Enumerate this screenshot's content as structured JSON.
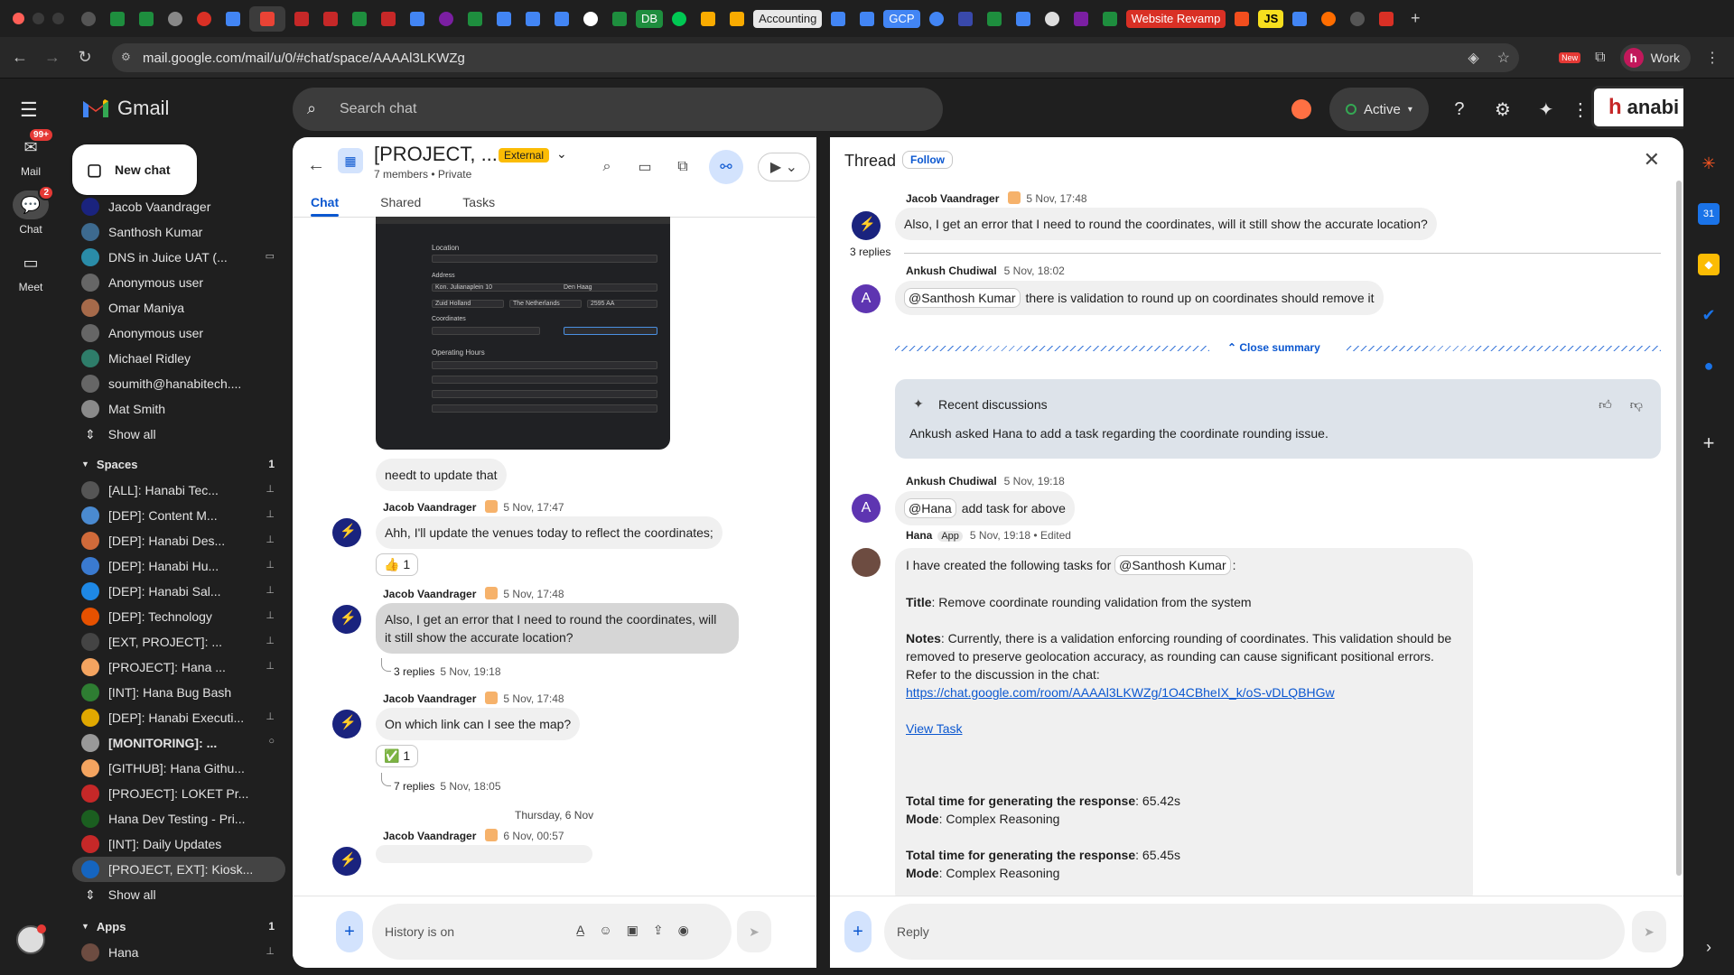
{
  "browser": {
    "tab_labels": {
      "db": "DB",
      "accounting": "Accounting",
      "gcp": "GCP",
      "website": "Website Revamp",
      "js": "JS"
    },
    "url": "mail.google.com/mail/u/0/#chat/space/AAAAl3LKWZg",
    "profile": "Work",
    "new_badge": "New"
  },
  "rail": {
    "mail_label": "Mail",
    "mail_badge": "99+",
    "chat_label": "Chat",
    "chat_badge": "2",
    "meet_label": "Meet"
  },
  "header": {
    "app_name": "Gmail",
    "search_placeholder": "Search chat",
    "status": "Active",
    "org_name": "anabi"
  },
  "sidebar": {
    "new_chat": "New chat",
    "dms": [
      {
        "name": "Jacob Vaandrager",
        "color": "#1a237e"
      },
      {
        "name": "Santhosh Kumar",
        "color": "#3d6a8f"
      },
      {
        "name": "DNS in Juice UAT (...",
        "color": "#2a8ca8"
      },
      {
        "name": "Anonymous user",
        "color": "#666"
      },
      {
        "name": "Omar Maniya",
        "color": "#a66a4a"
      },
      {
        "name": "Anonymous user",
        "color": "#666"
      },
      {
        "name": "Michael Ridley",
        "color": "#2e7d6a"
      },
      {
        "name": "soumith@hanabitech....",
        "color": "#666"
      },
      {
        "name": "Mat Smith",
        "color": "#8a8a8a"
      }
    ],
    "show_all": "Show all",
    "spaces_label": "Spaces",
    "spaces_count": "1",
    "spaces": [
      {
        "name": "[ALL]: Hanabi Tec...",
        "color": "#555"
      },
      {
        "name": "[DEP]: Content M...",
        "color": "#4a8ad0"
      },
      {
        "name": "[DEP]: Hanabi Des...",
        "color": "#d06a3a"
      },
      {
        "name": "[DEP]: Hanabi Hu...",
        "color": "#3a7ad0"
      },
      {
        "name": "[DEP]: Hanabi Sal...",
        "color": "#1e88e5"
      },
      {
        "name": "[DEP]: Technology",
        "color": "#e65100"
      },
      {
        "name": "[EXT, PROJECT]: ...",
        "color": "#444"
      },
      {
        "name": "[PROJECT]: Hana ...",
        "color": "#f4a460"
      },
      {
        "name": "[INT]: Hana Bug Bash",
        "color": "#2e7d32"
      },
      {
        "name": "[DEP]: Hanabi Executi...",
        "color": "#e0a800"
      },
      {
        "name": "[MONITORING]: ...",
        "color": "#999"
      },
      {
        "name": "[GITHUB]: Hana Githu...",
        "color": "#f4a460"
      },
      {
        "name": "[PROJECT]: LOKET Pr...",
        "color": "#c62828"
      },
      {
        "name": "Hana Dev Testing - Pri...",
        "color": "#1b5e20"
      },
      {
        "name": "[INT]: Daily Updates",
        "color": "#c62828"
      },
      {
        "name": "[PROJECT, EXT]: Kiosk...",
        "color": "#1565c0"
      }
    ],
    "show_all_spaces": "Show all",
    "apps_label": "Apps",
    "apps_count": "1",
    "apps": [
      {
        "name": "Hana",
        "color": "#6d4c41"
      }
    ]
  },
  "chat": {
    "title": "[PROJECT, ...",
    "external": "External",
    "members": "7 members",
    "privacy": "Private",
    "tabs": {
      "chat": "Chat",
      "shared": "Shared",
      "tasks": "Tasks"
    },
    "shot": {
      "location": "Location",
      "address": "Address",
      "coordinates": "Coordinates",
      "hours": "Operating Hours",
      "street": "Kon. Julianaplein 10",
      "city": "Den Haag",
      "region": "Zuid Holland",
      "country": "The Netherlands",
      "zip": "2595 AA"
    },
    "msg1": "needt to update that",
    "msg2_sender": "Jacob Vaandrager",
    "msg2_time": "5 Nov, 17:47",
    "msg2": "Ahh, I'll update the venues today to reflect the coordinates;",
    "msg2_react": "👍 1",
    "msg3_sender": "Jacob Vaandrager",
    "msg3_time": "5 Nov, 17:48",
    "msg3_line1": "Also, I get an error that I need to round the coordinates, will",
    "msg3_line2": "it still show the accurate location?",
    "msg3_replies": "3 replies",
    "msg3_replies_time": "5 Nov, 19:18",
    "msg4_sender": "Jacob Vaandrager",
    "msg4_time": "5 Nov, 17:48",
    "msg4": "On which link can I see the map?",
    "msg4_react": "✅ 1",
    "msg4_replies": "7 replies",
    "msg4_replies_time": "5 Nov, 18:05",
    "date_sep": "Thursday, 6 Nov",
    "msg5_sender": "Jacob Vaandrager",
    "msg5_time": "6 Nov, 00:57",
    "composer_placeholder": "History is on"
  },
  "thread": {
    "title": "Thread",
    "follow": "Follow",
    "t1_sender": "Jacob Vaandrager",
    "t1_time": "5 Nov, 17:48",
    "t1": "Also, I get an error that I need to round the coordinates, will it still show the accurate location?",
    "replies_count": "3 replies",
    "t2_sender": "Ankush Chudiwal",
    "t2_time": "5 Nov, 18:02",
    "t2_mention": "@Santhosh Kumar",
    "t2": "there is validation to round up on coordinates should remove it",
    "close_summary": "Close summary",
    "summary_title": "Recent discussions",
    "summary_text": "Ankush asked Hana to add a task regarding the coordinate rounding issue.",
    "t3_sender": "Ankush Chudiwal",
    "t3_time": "5 Nov, 19:18",
    "t3_mention": "@Hana",
    "t3": "add task for above",
    "t4_sender": "Hana",
    "t4_app": "App",
    "t4_time": "5 Nov, 19:18",
    "t4_edited": "Edited",
    "t4_intro": "I have created the following tasks for",
    "t4_mention": "@Santhosh Kumar",
    "t4_colon": ":",
    "t4_title_label": "Title",
    "t4_title": ": Remove coordinate rounding validation from the system",
    "t4_notes_label": "Notes",
    "t4_notes": ": Currently, there is a validation enforcing rounding of coordinates. This validation should be removed to preserve geolocation accuracy, as rounding can cause significant positional errors. Refer to the discussion in the chat:",
    "t4_link": "https://chat.google.com/room/AAAAl3LKWZg/1O4CBheIX_k/oS-vDLQBHGw",
    "t4_view": "View Task",
    "t4_total1_label": "Total time for generating the response",
    "t4_total1": ": 65.42s",
    "t4_mode_label": "Mode",
    "t4_mode": ": Complex Reasoning",
    "t4_total2_label": "Total time for generating the response",
    "t4_total2": ": 65.45s",
    "t4_mode2_label": "Mode",
    "t4_mode2": ": Complex Reasoning",
    "reply_placeholder": "Reply"
  }
}
